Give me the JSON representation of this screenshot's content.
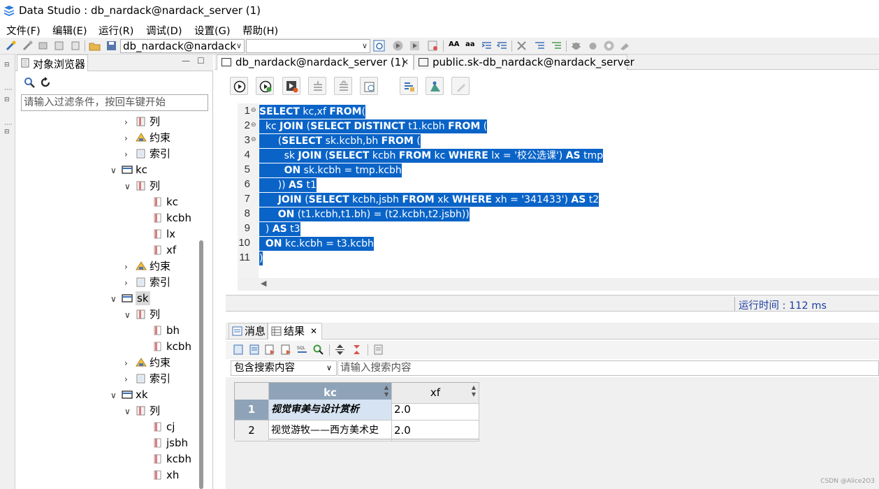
{
  "app": {
    "title": "Data Studio : db_nardack@nardack_server (1)"
  },
  "menu": [
    "文件(F)",
    "编辑(E)",
    "运行(R)",
    "调试(D)",
    "设置(G)",
    "帮助(H)"
  ],
  "toolbar": {
    "connection": "db_nardack@nardack",
    "schema": "",
    "font_a_large": "AA",
    "font_a_small": "aa"
  },
  "object_browser": {
    "tab_label": "对象浏览器",
    "filter_placeholder": "请输入过滤条件，按回车键开始",
    "tree": [
      {
        "label": "列",
        "type": "folder-col",
        "expanded": false
      },
      {
        "label": "约束",
        "type": "constraint",
        "expanded": false
      },
      {
        "label": "索引",
        "type": "index",
        "expanded": false
      },
      {
        "label": "kc",
        "type": "table",
        "expanded": true
      },
      {
        "label": "列",
        "type": "folder-col",
        "expanded": true
      },
      {
        "label": "kc",
        "type": "column"
      },
      {
        "label": "kcbh",
        "type": "column"
      },
      {
        "label": "lx",
        "type": "column"
      },
      {
        "label": "xf",
        "type": "column"
      },
      {
        "label": "约束",
        "type": "constraint",
        "expanded": false
      },
      {
        "label": "索引",
        "type": "index",
        "expanded": false
      },
      {
        "label": "sk",
        "type": "table",
        "expanded": true,
        "selected": true
      },
      {
        "label": "列",
        "type": "folder-col",
        "expanded": true
      },
      {
        "label": "bh",
        "type": "column"
      },
      {
        "label": "kcbh",
        "type": "column"
      },
      {
        "label": "约束",
        "type": "constraint",
        "expanded": false
      },
      {
        "label": "索引",
        "type": "index",
        "expanded": false
      },
      {
        "label": "xk",
        "type": "table",
        "expanded": true
      },
      {
        "label": "列",
        "type": "folder-col",
        "expanded": true
      },
      {
        "label": "cj",
        "type": "column"
      },
      {
        "label": "jsbh",
        "type": "column"
      },
      {
        "label": "kcbh",
        "type": "column"
      },
      {
        "label": "xh",
        "type": "column"
      }
    ]
  },
  "editor": {
    "tabs": [
      "db_nardack@nardack_server (1)",
      "public.sk-db_nardack@nardack_server"
    ],
    "lines": [
      {
        "n": "1",
        "text": "SELECT kc,xf FROM("
      },
      {
        "n": "2",
        "text": "  kc JOIN (SELECT DISTINCT t1.kcbh FROM ("
      },
      {
        "n": "3",
        "text": "      (SELECT sk.kcbh,bh FROM ("
      },
      {
        "n": "4",
        "text": "        sk JOIN (SELECT kcbh FROM kc WHERE lx = '校公选课') AS tmp"
      },
      {
        "n": "5",
        "text": "        ON sk.kcbh = tmp.kcbh"
      },
      {
        "n": "6",
        "text": "      )) AS t1"
      },
      {
        "n": "7",
        "text": "      JOIN (SELECT kcbh,jsbh FROM xk WHERE xh = '341433') AS t2"
      },
      {
        "n": "8",
        "text": "      ON (t1.kcbh,t1.bh) = (t2.kcbh,t2.jsbh))"
      },
      {
        "n": "9",
        "text": "  ) AS t3"
      },
      {
        "n": "10",
        "text": "  ON kc.kcbh = t3.kcbh"
      },
      {
        "n": "11",
        "text": ")"
      }
    ],
    "runtime": "运行时间 : 112 ms"
  },
  "results": {
    "tabs": [
      "消息",
      "结果"
    ],
    "search_mode": "包含搜索内容",
    "search_placeholder": "请输入搜索内容",
    "columns": [
      "kc",
      "xf"
    ],
    "rows": [
      {
        "num": "1",
        "kc": "视觉审美与设计赏析",
        "xf": "2.0"
      },
      {
        "num": "2",
        "kc": "视觉游牧——西方美术史",
        "xf": "2.0"
      }
    ]
  },
  "watermark": "CSDN @Alice2O3",
  "colors": {
    "selection": "#0a64c8",
    "header_selected": "#8fa3b8",
    "runtime_text": "#1f3fa0"
  }
}
